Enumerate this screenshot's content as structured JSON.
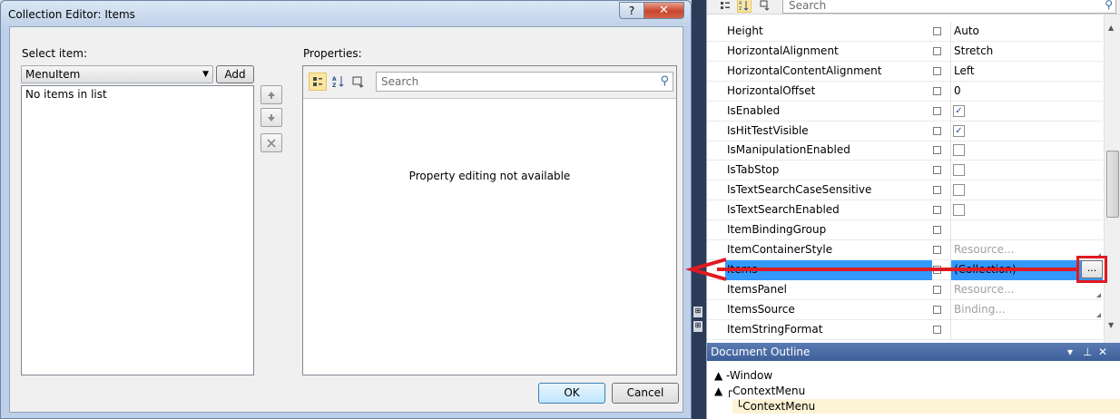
{
  "dialog": {
    "title": "Collection Editor: Items",
    "help_label": "?",
    "close_label": "✕",
    "select_item_label": "Select item:",
    "type_selected": "MenuItem",
    "add_label": "Add",
    "list_empty_text": "No items in list",
    "properties_label": "Properties:",
    "search_placeholder": "Search",
    "not_available_text": "Property editing not available",
    "ok_label": "OK",
    "cancel_label": "Cancel",
    "move_up_icon": "arrow-up-icon",
    "move_down_icon": "arrow-down-icon",
    "remove_icon": "remove-x-icon"
  },
  "properties_window": {
    "search_placeholder": "Search",
    "rows": [
      {
        "name": "Height",
        "kind": "text",
        "value": "Auto"
      },
      {
        "name": "HorizontalAlignment",
        "kind": "text",
        "value": "Stretch"
      },
      {
        "name": "HorizontalContentAlignment",
        "kind": "text",
        "value": "Left"
      },
      {
        "name": "HorizontalOffset",
        "kind": "text",
        "value": "0"
      },
      {
        "name": "IsEnabled",
        "kind": "check",
        "checked": true
      },
      {
        "name": "IsHitTestVisible",
        "kind": "check",
        "checked": true
      },
      {
        "name": "IsManipulationEnabled",
        "kind": "check",
        "checked": false
      },
      {
        "name": "IsTabStop",
        "kind": "check",
        "checked": false
      },
      {
        "name": "IsTextSearchCaseSensitive",
        "kind": "check",
        "checked": false
      },
      {
        "name": "IsTextSearchEnabled",
        "kind": "check",
        "checked": false
      },
      {
        "name": "ItemBindingGroup",
        "kind": "text",
        "value": ""
      },
      {
        "name": "ItemContainerStyle",
        "kind": "muted",
        "value": "Resource..."
      },
      {
        "name": "Items",
        "kind": "selected",
        "value": "(Collection)"
      },
      {
        "name": "ItemsPanel",
        "kind": "muted",
        "value": "Resource..."
      },
      {
        "name": "ItemsSource",
        "kind": "muted",
        "value": "Binding..."
      },
      {
        "name": "ItemStringFormat",
        "kind": "text",
        "value": ""
      }
    ],
    "ellipsis_label": "..."
  },
  "document_outline": {
    "title": "Document Outline",
    "controls": [
      "▾",
      "⊥",
      "✕"
    ],
    "tree": [
      {
        "prefix": "▲ -",
        "label": "Window"
      },
      {
        "prefix": "▲ ┌",
        "label": "ContextMenu"
      },
      {
        "prefix": "└",
        "label": "ContextMenu"
      }
    ]
  },
  "colors": {
    "selection": "#3399ff",
    "annotation_red": "#e01a22",
    "outline_header": "#4a6aa6"
  }
}
